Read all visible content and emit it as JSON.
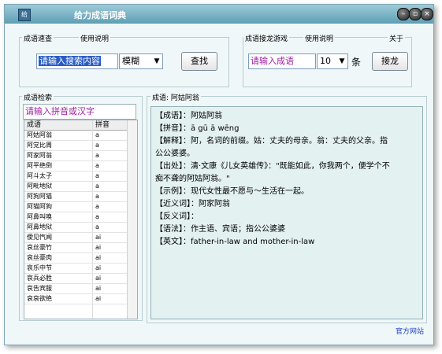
{
  "window": {
    "title": "给力成语词典",
    "icon_text": "给"
  },
  "title_buttons": {
    "minimize": "–",
    "restore": "▫",
    "close": "×"
  },
  "quick_search": {
    "group_label": "成语速查",
    "help_label": "使用说明",
    "input_value": "请输入搜索内容",
    "mode_value": "模糊",
    "search_button": "查找"
  },
  "chain_game": {
    "group_label": "成语接龙游戏",
    "help_label": "使用说明",
    "about_label": "关于",
    "input_value": "请输入成语",
    "count_value": "10",
    "count_unit": "条",
    "start_button": "接龙"
  },
  "index": {
    "group_label": "成语检索",
    "input_placeholder": "请输入拼音或汉字",
    "columns": [
      "成语",
      "拼音"
    ],
    "rows": [
      [
        "阿姑阿翁",
        "a"
      ],
      [
        "阿党比周",
        "a"
      ],
      [
        "阿家阿翁",
        "a"
      ],
      [
        "阿平绝倒",
        "a"
      ],
      [
        "阿斗太子",
        "a"
      ],
      [
        "阿毗地狱",
        "a"
      ],
      [
        "阿狗阿猫",
        "a"
      ],
      [
        "阿猫阿狗",
        "a"
      ],
      [
        "阿鼻叫唤",
        "a"
      ],
      [
        "阿鼻地狱",
        "a"
      ],
      [
        "僾见忾闻",
        "ai"
      ],
      [
        "哀丝豪竹",
        "ai"
      ],
      [
        "哀丝豪肉",
        "ai"
      ],
      [
        "哀乐中节",
        "ai"
      ],
      [
        "哀兵必胜",
        "ai"
      ],
      [
        "哀告宾服",
        "ai"
      ],
      [
        "哀哀欲绝",
        "ai"
      ]
    ]
  },
  "detail": {
    "group_label": "成语: 阿姑阿翁",
    "lines": [
      {
        "key": "【成语】",
        "text": "：阿姑阿翁"
      },
      {
        "key": "【拼音】",
        "text": "：ā gū ā wēng"
      },
      {
        "key": "【解释】",
        "text": "：阿，名词的前缀。姑：丈夫的母亲。翁：丈夫的父亲。指"
      },
      {
        "key": "",
        "text": "公公婆婆。"
      },
      {
        "key": "【出处】",
        "text": "：清·文康《儿女英雄传》：\"既能如此，你我两个，便学个不"
      },
      {
        "key": "",
        "text": "痴不聋的阿姑阿翁。\""
      },
      {
        "key": "【示例】",
        "text": "：现代女性最不愿与～生活在一起。"
      },
      {
        "key": "【近义词】",
        "text": "：阿家阿翁"
      },
      {
        "key": "【反义词】",
        "text": "："
      },
      {
        "key": "【语法】",
        "text": "：作主语、宾语；指公公婆婆"
      },
      {
        "key": "【英文】",
        "text": "：father-in-law and mother-in-law"
      }
    ]
  },
  "footer": {
    "link": "官方网站"
  },
  "colors": {
    "title_bar": "#5e9fb4",
    "window_bg": "#f0f7f8",
    "detail_bg": "#e3f1f1",
    "accent_text": "#a020a0",
    "link": "#1a3fbf"
  }
}
